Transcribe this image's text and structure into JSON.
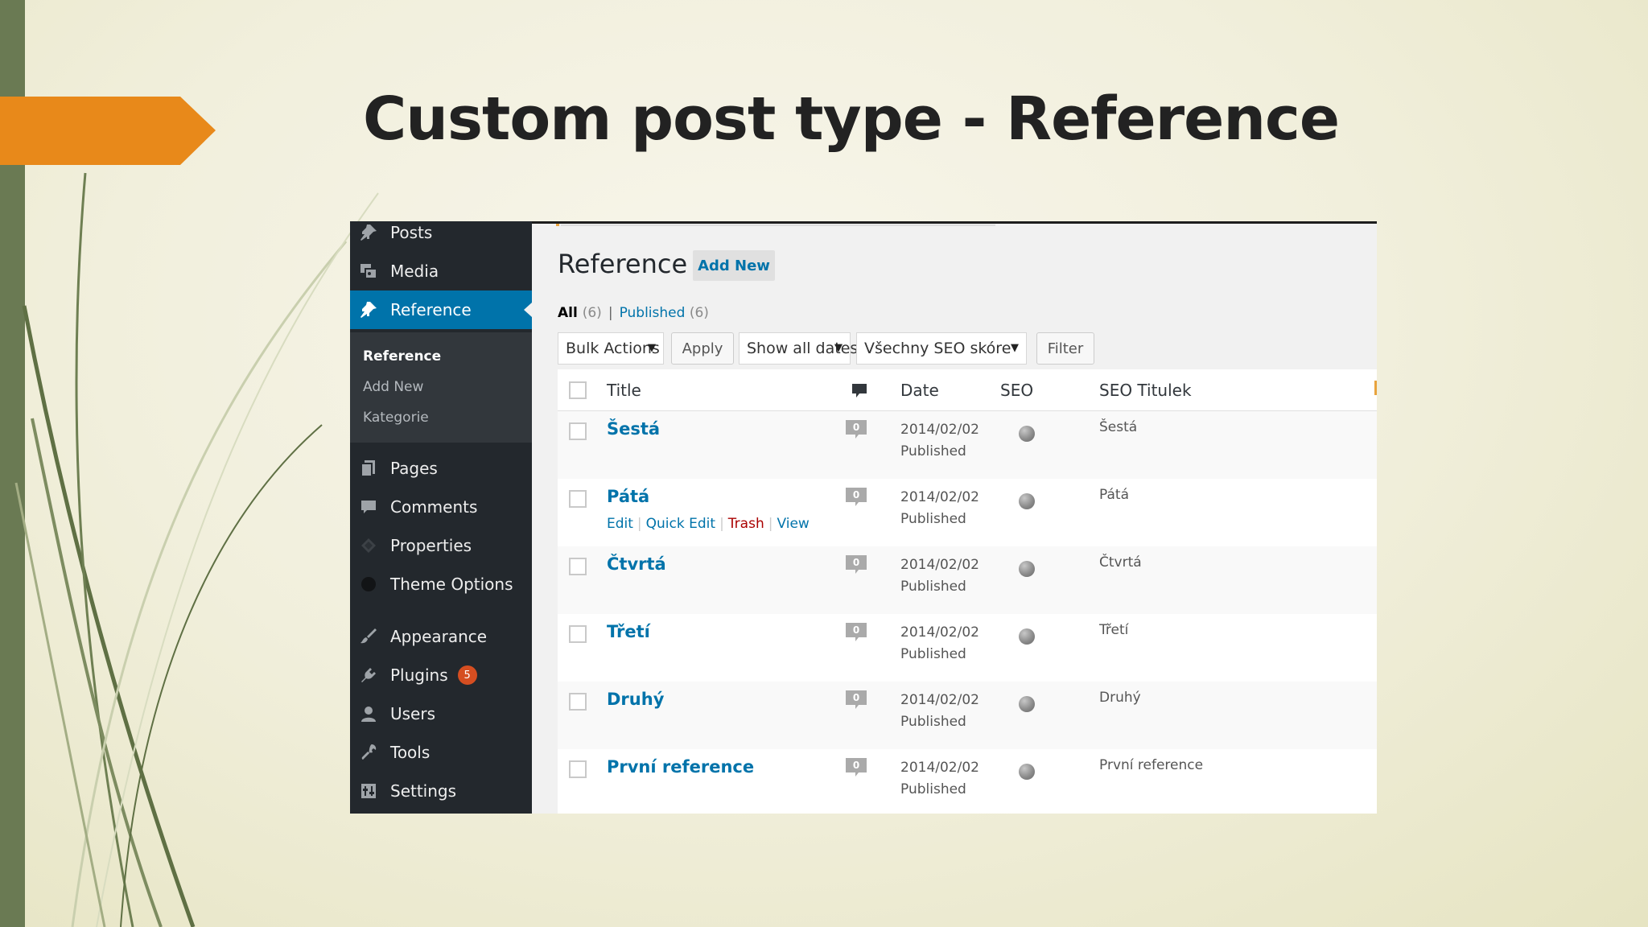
{
  "slide": {
    "title": "Custom post type - Reference"
  },
  "sidebar": {
    "items": [
      {
        "label": "Posts",
        "icon": "pin-icon"
      },
      {
        "label": "Media",
        "icon": "media-icon"
      },
      {
        "label": "Reference",
        "icon": "pin-icon",
        "active": true
      },
      {
        "label": "Pages",
        "icon": "pages-icon"
      },
      {
        "label": "Comments",
        "icon": "comment-icon"
      },
      {
        "label": "Properties",
        "icon": "properties-icon"
      },
      {
        "label": "Theme Options",
        "icon": "circle-icon"
      },
      {
        "label": "Appearance",
        "icon": "brush-icon"
      },
      {
        "label": "Plugins",
        "icon": "plug-icon",
        "badge": "5"
      },
      {
        "label": "Users",
        "icon": "user-icon"
      },
      {
        "label": "Tools",
        "icon": "wrench-icon"
      },
      {
        "label": "Settings",
        "icon": "settings-icon"
      }
    ],
    "submenu": [
      "Reference",
      "Add New",
      "Kategorie"
    ]
  },
  "main": {
    "page_title": "Reference",
    "add_new": "Add New",
    "filters": {
      "all_label": "All",
      "all_count": "(6)",
      "separator": "|",
      "published_label": "Published",
      "published_count": "(6)"
    },
    "bulk_actions": "Bulk Actions",
    "apply": "Apply",
    "dates": "Show all dates",
    "seo_filter": "Všechny SEO skóre",
    "filter": "Filter",
    "columns": {
      "title": "Title",
      "date": "Date",
      "seo": "SEO",
      "seo_title": "SEO Titulek"
    },
    "row_actions": [
      "Edit",
      "Quick Edit",
      "Trash",
      "View"
    ],
    "rows": [
      {
        "title": "Šestá",
        "comments": "0",
        "date": "2014/02/02",
        "status": "Published",
        "seo_title": "Šestá"
      },
      {
        "title": "Pátá",
        "comments": "0",
        "date": "2014/02/02",
        "status": "Published",
        "seo_title": "Pátá"
      },
      {
        "title": "Čtvrtá",
        "comments": "0",
        "date": "2014/02/02",
        "status": "Published",
        "seo_title": "Čtvrtá"
      },
      {
        "title": "Třetí",
        "comments": "0",
        "date": "2014/02/02",
        "status": "Published",
        "seo_title": "Třetí"
      },
      {
        "title": "Druhý",
        "comments": "0",
        "date": "2014/02/02",
        "status": "Published",
        "seo_title": "Druhý"
      },
      {
        "title": "První reference",
        "comments": "0",
        "date": "2014/02/02",
        "status": "Published",
        "seo_title": "První reference"
      }
    ]
  },
  "colors": {
    "accent_orange": "#e8891a",
    "wp_blue": "#0073aa",
    "sidebar_bg": "#23282d",
    "band_green": "#6a7a53"
  }
}
